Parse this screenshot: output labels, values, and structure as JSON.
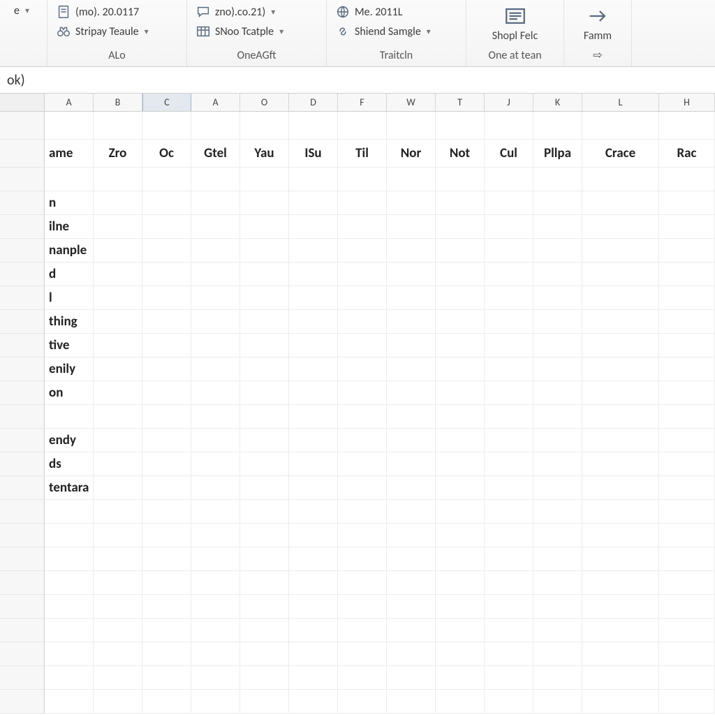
{
  "ribbon": {
    "group0": {
      "item1_label": "e",
      "caption": ""
    },
    "group1": {
      "top_label": "(mo). 20.0117",
      "item_label": "Stripay Teaule",
      "caption": "ALo"
    },
    "group2": {
      "top_label": "zno).co.21)",
      "item_label": "SNoo Tcatple",
      "caption": "OneAGft"
    },
    "group3": {
      "top_label": "Me. 2011L",
      "item_label": "Shiend Samgle",
      "caption": "Traitcln"
    },
    "group4": {
      "btn_label": "Shopl Felc",
      "caption": "One at tean"
    },
    "group5": {
      "btn_label": "Famm"
    }
  },
  "formula_bar": {
    "text": "ok)"
  },
  "columns": [
    "A",
    "B",
    "C",
    "A",
    "O",
    "D",
    "F",
    "W",
    "T",
    "J",
    "K",
    "L",
    "H"
  ],
  "selected_col_index": 2,
  "header_row": [
    "ame",
    "Zro",
    "Oc",
    "Gtel",
    "Yau",
    "ISu",
    "Til",
    "Nor",
    "Not",
    "Cul",
    "Pllpa",
    "Crace",
    "Rac"
  ],
  "rowA_values": [
    "",
    "n",
    "ilne",
    "nanple",
    "d",
    "l",
    "thing",
    "tive",
    "enily",
    "on",
    "",
    "endy",
    "ds",
    "tentara",
    "",
    "",
    "",
    "",
    "",
    "",
    "",
    "",
    ""
  ]
}
